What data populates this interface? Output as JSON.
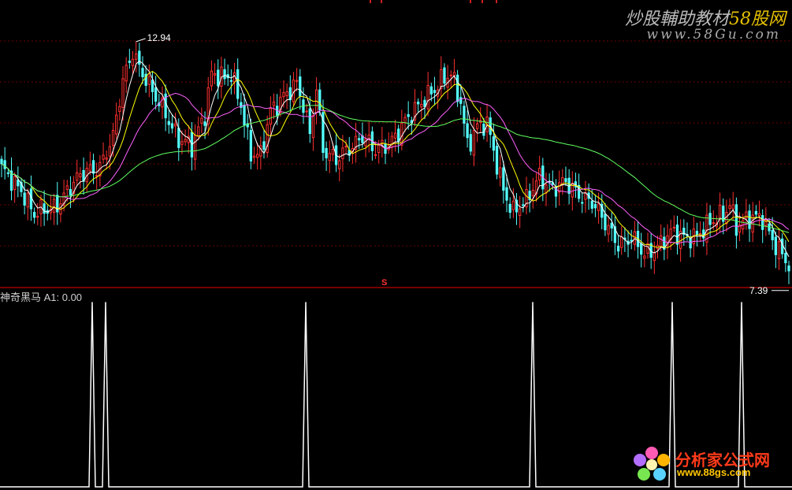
{
  "watermark": {
    "title_main": "炒股輔助教材",
    "title_accent": "58股网",
    "url": "www.58Gu.com"
  },
  "logo": {
    "text": "分析家公式网",
    "url": "www.88gs.com"
  },
  "indicator": {
    "label": "神奇黑马  A1: 0.00"
  },
  "chart_data": [
    {
      "type": "candlestick",
      "title": "",
      "ylim": [
        7.0,
        13.3
      ],
      "annotations": {
        "high_label": "12.94",
        "low_label": "7.39",
        "divider_mark": "S"
      },
      "colors": {
        "up": "#ff3030",
        "down": "#54ffff",
        "ma5": "#ffffff",
        "ma10": "#ffff00",
        "ma20": "#ff60ff",
        "ma60": "#60ff60",
        "grid": "#6a0000",
        "divider": "#a00000"
      },
      "grid": true,
      "series": [
        {
          "values": []
        }
      ]
    },
    {
      "type": "line",
      "title": "",
      "ylim": [
        0,
        1
      ],
      "colors": {
        "line": "#ffffff"
      },
      "spike_positions": [
        117,
        134,
        388,
        676,
        853,
        941
      ]
    }
  ]
}
